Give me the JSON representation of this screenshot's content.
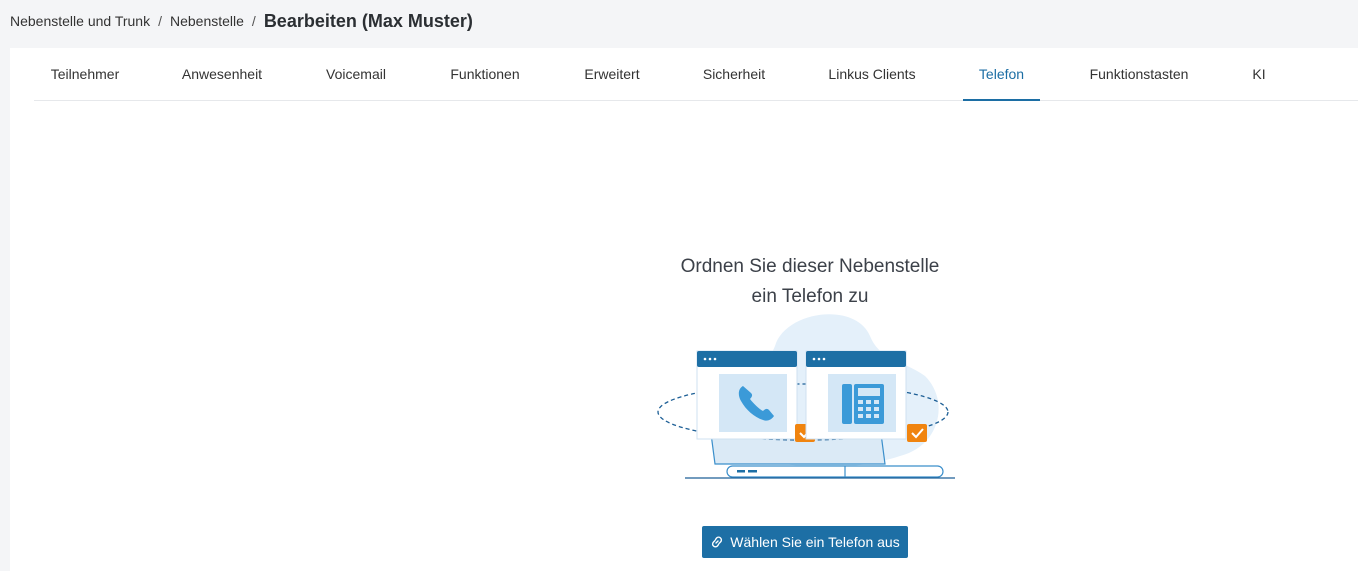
{
  "breadcrumb": {
    "items": [
      "Nebenstelle und Trunk",
      "Nebenstelle"
    ],
    "separator": "/",
    "current": "Bearbeiten (Max Muster)"
  },
  "tabs": [
    {
      "label": "Teilnehmer",
      "active": false
    },
    {
      "label": "Anwesenheit",
      "active": false
    },
    {
      "label": "Voicemail",
      "active": false
    },
    {
      "label": "Funktionen",
      "active": false
    },
    {
      "label": "Erweitert",
      "active": false
    },
    {
      "label": "Sicherheit",
      "active": false
    },
    {
      "label": "Linkus Clients",
      "active": false
    },
    {
      "label": "Telefon",
      "active": true
    },
    {
      "label": "Funktionstasten",
      "active": false
    },
    {
      "label": "KI",
      "active": false
    }
  ],
  "empty_state": {
    "title_line1": "Ordnen Sie dieser Nebenstelle",
    "title_line2": "ein Telefon zu",
    "illustration_icons": [
      "phone-handset-icon",
      "desk-phone-icon",
      "checkmark-icon"
    ]
  },
  "action": {
    "select_phone_label": "Wählen Sie ein Telefon aus",
    "icon": "link-icon"
  },
  "colors": {
    "accent": "#1c6ea4",
    "button_bg": "#1d6fa5",
    "check_badge": "#f0840f",
    "page_bg": "#f4f5f7"
  }
}
